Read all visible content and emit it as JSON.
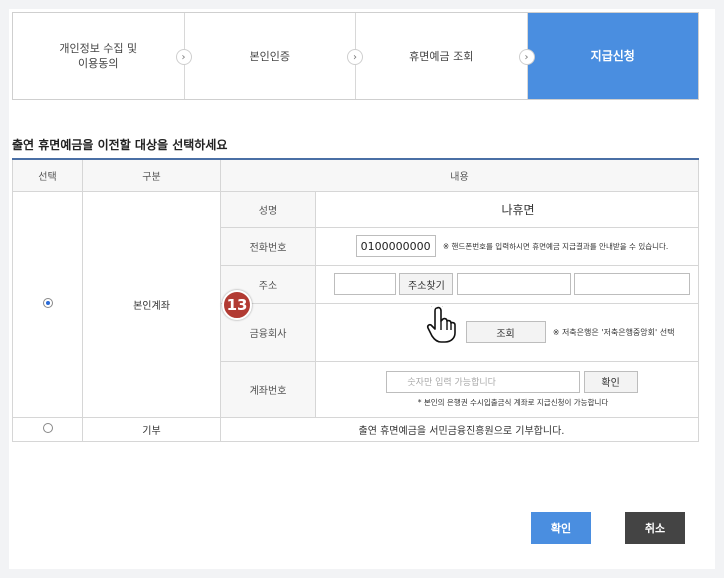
{
  "steps": [
    {
      "label_line1": "개인정보 수집 및",
      "label_line2": "이용동의",
      "active": false
    },
    {
      "label": "본인인증",
      "active": false
    },
    {
      "label": "휴면예금 조회",
      "active": false
    },
    {
      "label": "지급신청",
      "active": true
    }
  ],
  "section_title": "출연 휴면예금을 이전할 대상을 선택하세요",
  "table": {
    "headers": {
      "select": "선택",
      "category": "구분",
      "content": "내용"
    },
    "row_account": {
      "category": "본인계좌",
      "selected": true,
      "fields": {
        "name_label": "성명",
        "name_value": "나휴면",
        "phone_label": "전화번호",
        "phone_value": "0100000000",
        "phone_note": "※ 핸드폰번호를 입력하시면 휴면예금 지급결과를 안내받을 수 있습니다.",
        "address_label": "주소",
        "address_button": "주소찾기",
        "bank_label": "금융회사",
        "bank_button": "조회",
        "bank_note": "※ 저축은행은 '저축은행중앙회' 선택",
        "account_label": "계좌번호",
        "account_placeholder": "숫자만 입력 가능합니다",
        "account_button": "확인",
        "account_note": "* 본인의 은행권 수시입출금식 계좌로 지급신청이 가능합니다"
      }
    },
    "row_donation": {
      "category": "기부",
      "selected": false,
      "content": "출연 휴면예금을 서민금융진흥원으로 기부합니다."
    }
  },
  "badge": "13",
  "buttons": {
    "confirm": "확인",
    "cancel": "취소"
  },
  "colors": {
    "accent": "#4a8ee0",
    "badge": "#b23b33",
    "cancel": "#444444"
  }
}
